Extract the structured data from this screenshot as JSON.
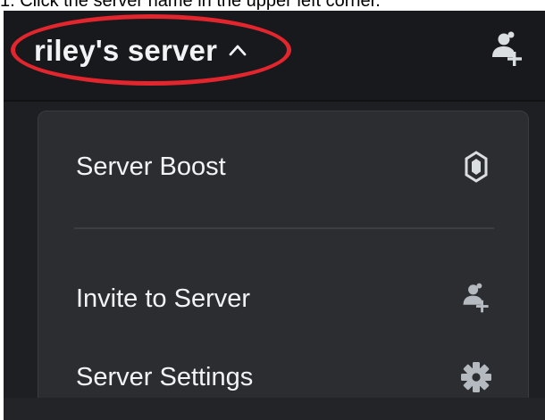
{
  "caption": "1. Click the server name in the upper left corner.",
  "header": {
    "server_name": "riley's server"
  },
  "menu": {
    "items": [
      {
        "label": "Server Boost",
        "icon": "boost-gem-icon"
      },
      {
        "label": "Invite to Server",
        "icon": "add-member-icon"
      },
      {
        "label": "Server Settings",
        "icon": "gear-icon"
      }
    ]
  },
  "colors": {
    "background": "#1e1f22",
    "header": "#18191c",
    "menu": "#2b2d31",
    "text": "#f2f3f5",
    "icon": "#b5bac1",
    "highlight": "#e3262e"
  }
}
